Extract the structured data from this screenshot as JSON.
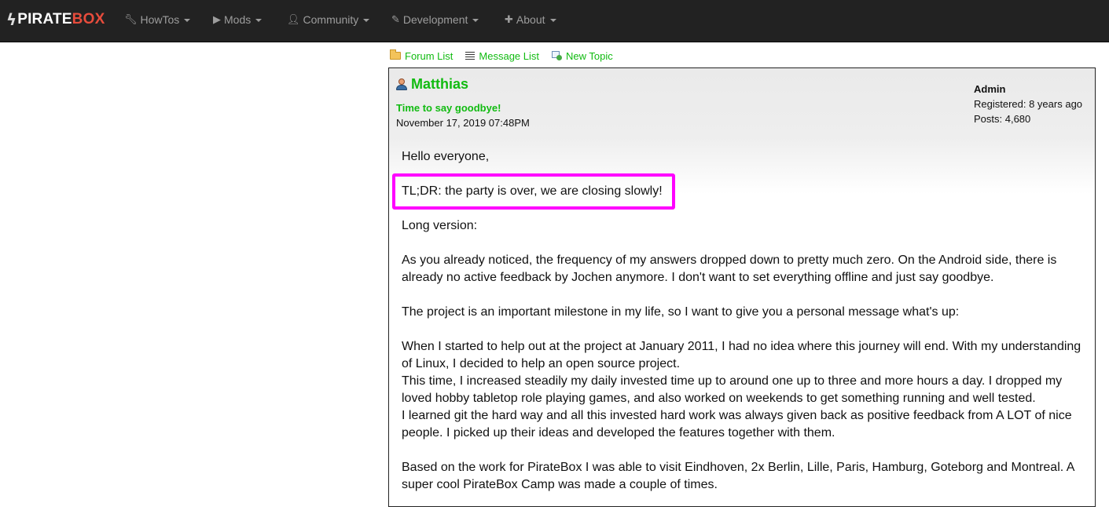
{
  "brand": {
    "part1": "PIRATE",
    "part2": "BOX",
    "accent_color": "#e74c3c"
  },
  "nav": [
    {
      "label": "HowTos",
      "icon": "wrench-icon"
    },
    {
      "label": "Mods",
      "icon": "play-icon"
    },
    {
      "label": "Community",
      "icon": "user-icon"
    },
    {
      "label": "Development",
      "icon": "pencil-icon"
    },
    {
      "label": "About",
      "icon": "plus-icon"
    }
  ],
  "forum_links": {
    "forum_list": "Forum List",
    "message_list": "Message List",
    "new_topic": "New Topic"
  },
  "post": {
    "author": "Matthias",
    "title": "Time to say goodbye!",
    "date": "November 17, 2019 07:48PM",
    "role": "Admin",
    "registered": "Registered: 8 years ago",
    "posts": "Posts: 4,680",
    "paragraphs": [
      "Hello everyone,",
      "TL;DR: the party is over, we are closing slowly!",
      "Long version:",
      "As you already noticed, the frequency of my answers dropped down to pretty much zero. On the Android side, there is already no active feedback by Jochen anymore. I don't want to set everything offline and just say goodbye.",
      "The project is an important milestone in my life, so I want to give you a personal message what's up:",
      "When I started to help out at the project at January 2011, I had no idea where this journey will end. With my understanding of Linux, I decided to help an open source project.",
      "This time, I increased steadily my daily invested time up to around one up to three and more hours a day. I dropped my loved hobby tabletop role playing games, and also worked on weekends to get something running and well tested.",
      "I learned git the hard way and all this invested hard work was always given back as positive feedback from A LOT of nice people. I picked up their ideas and developed the features together with them.",
      "Based on the work for PirateBox I was able to visit Eindhoven, 2x Berlin, Lille, Paris, Hamburg, Goteborg and Montreal. A super cool PirateBox Camp was made a couple of times."
    ]
  },
  "colors": {
    "link_green": "#11bb11",
    "highlight": "#ff00ff",
    "navbar_bg": "#222222"
  }
}
